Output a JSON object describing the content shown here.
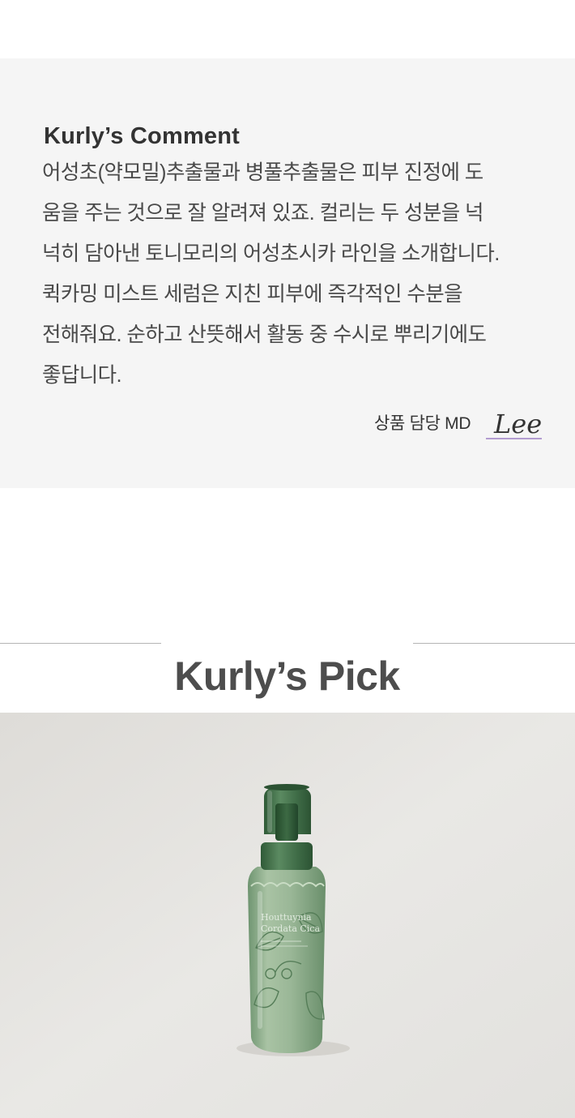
{
  "comment": {
    "title": "Kurly’s Comment",
    "lines": [
      "어성초(약모밀)추출물과 병풀추출물은 피부 진정에 도",
      "움을 주는 것으로 잘 알려져 있죠. 컬리는 두 성분을 넉",
      "넉히 담아낸 토니모리의 어성초시카 라인을 소개합니다.",
      "퀵카밍 미스트 세럼은 지친 피부에 즉각적인 수분을",
      "전해줘요. 순하고 산뜻해서 활동 중 수시로 뿌리기에도",
      "좋답니다."
    ],
    "md_label": "상품 담당 MD",
    "signature": "Lee",
    "signature_color": "#9b7fc4"
  },
  "pick": {
    "title": "Kurly’s Pick"
  },
  "product_image": {
    "label_line1": "Houttuynia",
    "label_line2": "Cordata Cica",
    "bottle_color": "#8fae8c",
    "cap_color": "#3e6b46",
    "background_color": "#e4e3df"
  }
}
